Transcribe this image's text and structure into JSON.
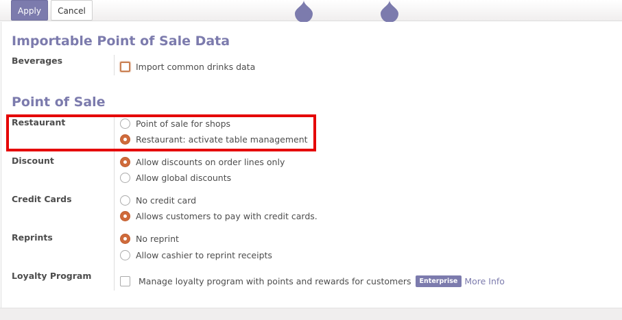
{
  "toolbar": {
    "apply_label": "Apply",
    "cancel_label": "Cancel",
    "drop_icons": [
      "drop-icon",
      "drop-icon"
    ]
  },
  "importable": {
    "title": "Importable Point of Sale Data",
    "beverages_label": "Beverages",
    "beverages_option": "Import common drinks data",
    "beverages_checked": false
  },
  "pos": {
    "title": "Point of Sale",
    "restaurant": {
      "label": "Restaurant",
      "options": [
        "Point of sale for shops",
        "Restaurant: activate table management"
      ],
      "selected": 1
    },
    "discount": {
      "label": "Discount",
      "options": [
        "Allow discounts on order lines only",
        "Allow global discounts"
      ],
      "selected": 0
    },
    "credit_cards": {
      "label": "Credit Cards",
      "options": [
        "No credit card",
        "Allows customers to pay with credit cards."
      ],
      "selected": 1
    },
    "reprints": {
      "label": "Reprints",
      "options": [
        "No reprint",
        "Allow cashier to reprint receipts"
      ],
      "selected": 0
    },
    "loyalty": {
      "label": "Loyalty Program",
      "option": "Manage loyalty program with points and rewards for customers",
      "badge": "Enterprise",
      "link": "More Info",
      "checked": false
    }
  },
  "colors": {
    "accent": "#7c7bad",
    "radio_checked": "#cf6b3c",
    "highlight": "#e50000"
  }
}
